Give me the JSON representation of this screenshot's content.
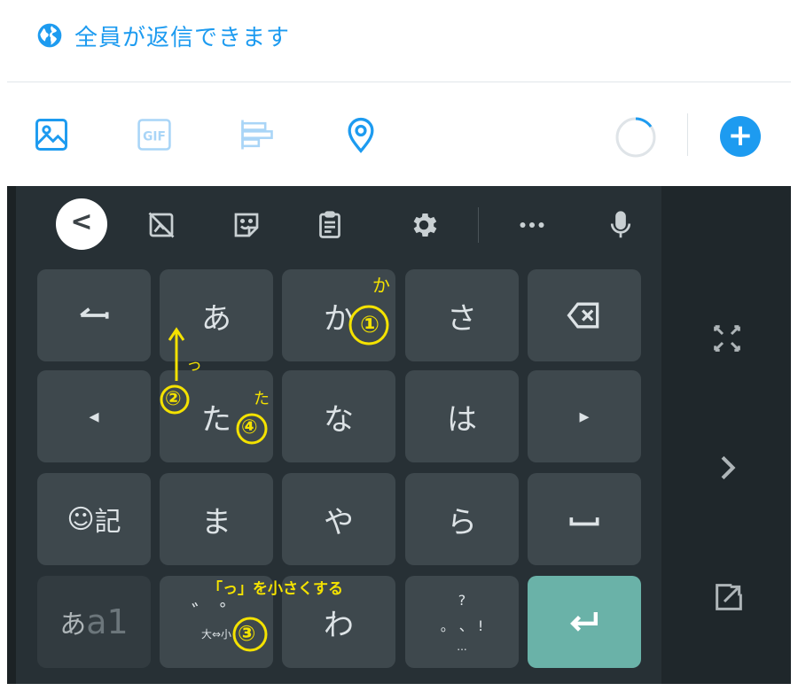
{
  "reply_setting": {
    "label": "全員が返信できます",
    "icon": "globe-icon"
  },
  "toolbar": {
    "items": [
      {
        "name": "image-icon"
      },
      {
        "name": "gif-icon",
        "label": "GIF"
      },
      {
        "name": "poll-icon"
      },
      {
        "name": "location-icon"
      }
    ],
    "char_progress_icon": "character-counter-ring",
    "add_icon": "plus-icon",
    "add_label": "+"
  },
  "keyboard": {
    "top_bar": {
      "back_label": "<",
      "icons": [
        "back-chevron-icon",
        "no-image-icon",
        "sticker-icon",
        "clipboard-icon",
        "settings-gear-icon",
        "more-dots-icon",
        "microphone-icon"
      ]
    },
    "rows": [
      [
        "←",
        "あ",
        "か",
        "さ",
        "⌫"
      ],
      [
        "◂",
        "た",
        "な",
        "は",
        "▸"
      ],
      [
        "☺記",
        "ま",
        "や",
        "ら",
        "␣"
      ],
      [
        "あa1",
        "゛゜",
        "わ",
        "、。?!",
        "↵"
      ]
    ],
    "mode_key": {
      "kana": "あ",
      "alpha": "a1"
    },
    "emoji_key": {
      "face": "☺",
      "label": "記"
    },
    "dakuten_key": {
      "top": "゛ ゜",
      "bottom": "大⇔小"
    },
    "punct_key": {
      "q": "?",
      "row": "。 、 !",
      "dots": "..."
    },
    "side_icons": [
      "expand-icon",
      "chevron-right-icon",
      "pop-out-icon"
    ]
  },
  "annotations": {
    "note_ka_small": "か",
    "num1": "①",
    "tsu_small": "っ",
    "num2": "②",
    "ta_small": "た",
    "num4": "④",
    "note_make_small": "「っ」を小さくする",
    "num3": "③"
  },
  "colors": {
    "accent": "#1d9bf0",
    "enter": "#6ab2a8",
    "annotation": "#f4e200"
  }
}
